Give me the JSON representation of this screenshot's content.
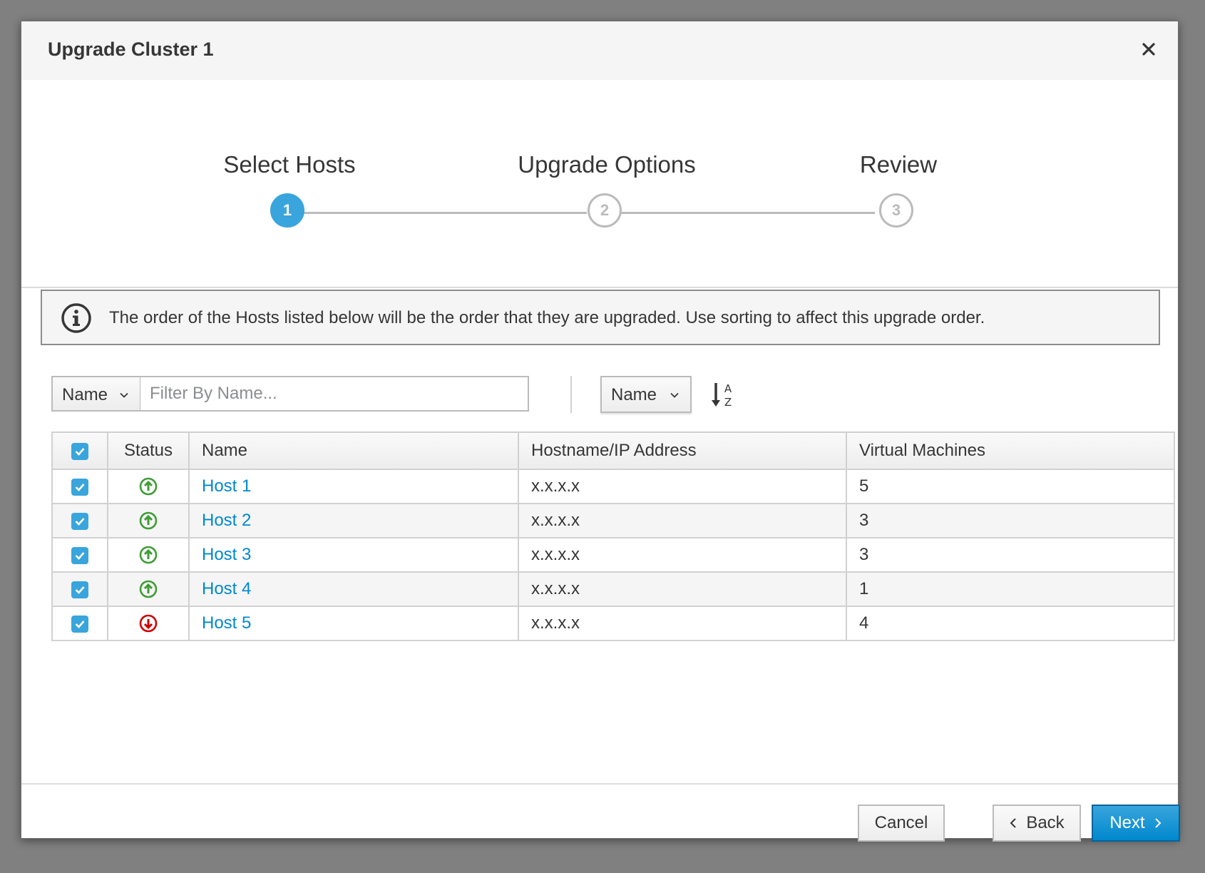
{
  "dialog": {
    "title": "Upgrade Cluster 1",
    "close_icon": "close-icon"
  },
  "wizard": {
    "steps": [
      {
        "label": "Select Hosts",
        "number": "1",
        "state": "active"
      },
      {
        "label": "Upgrade Options",
        "number": "2",
        "state": "inactive"
      },
      {
        "label": "Review",
        "number": "3",
        "state": "inactive"
      }
    ]
  },
  "alert": {
    "icon": "info-icon",
    "text": "The order of the Hosts listed below will be the order that they are upgraded. Use sorting to affect this upgrade order."
  },
  "toolbar": {
    "filter_field": "Name",
    "filter_placeholder": "Filter By Name...",
    "filter_value": "",
    "sort_field": "Name",
    "sort_direction_icon": "sort-alpha-asc-icon"
  },
  "table": {
    "columns": [
      "Status",
      "Name",
      "Hostname/IP Address",
      "Virtual Machines"
    ],
    "select_all_checked": true,
    "rows": [
      {
        "checked": true,
        "status": "up",
        "name": "Host 1",
        "address": "x.x.x.x",
        "vms": "5"
      },
      {
        "checked": true,
        "status": "up",
        "name": "Host 2",
        "address": "x.x.x.x",
        "vms": "3"
      },
      {
        "checked": true,
        "status": "up",
        "name": "Host 3",
        "address": "x.x.x.x",
        "vms": "3"
      },
      {
        "checked": true,
        "status": "up",
        "name": "Host 4",
        "address": "x.x.x.x",
        "vms": "1"
      },
      {
        "checked": true,
        "status": "down",
        "name": "Host 5",
        "address": "x.x.x.x",
        "vms": "4"
      }
    ]
  },
  "footer": {
    "cancel_label": "Cancel",
    "back_label": "Back",
    "next_label": "Next"
  },
  "colors": {
    "accent": "#39a5dc",
    "primary_button": "#0088ce",
    "link": "#0088ce",
    "status_up": "#3f9c35",
    "status_down": "#cc0000"
  }
}
